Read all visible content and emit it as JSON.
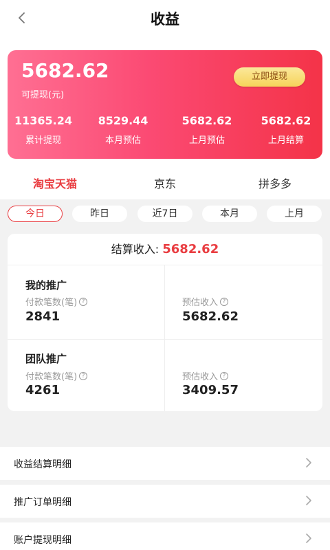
{
  "header": {
    "title": "收益"
  },
  "card": {
    "balance": "5682.62",
    "balance_label": "可提现(元)",
    "withdraw_button": "立即提现",
    "stats": [
      {
        "value": "11365.24",
        "label": "累计提现"
      },
      {
        "value": "8529.44",
        "label": "本月预估"
      },
      {
        "value": "5682.62",
        "label": "上月预估"
      },
      {
        "value": "5682.62",
        "label": "上月结算"
      }
    ]
  },
  "platform_tabs": [
    {
      "label": "淘宝天猫",
      "active": true
    },
    {
      "label": "京东",
      "active": false
    },
    {
      "label": "拼多多",
      "active": false
    }
  ],
  "periods": [
    {
      "label": "今日",
      "active": true
    },
    {
      "label": "昨日",
      "active": false
    },
    {
      "label": "近7日",
      "active": false
    },
    {
      "label": "本月",
      "active": false
    },
    {
      "label": "上月",
      "active": false
    }
  ],
  "summary": {
    "settle_label": "结算收入:",
    "settle_amount": "5682.62",
    "my_promo": {
      "title": "我的推广",
      "count_label": "付款笔数(笔)",
      "count": "2841",
      "income_label": "预估收入",
      "income": "5682.62"
    },
    "team_promo": {
      "title": "团队推广",
      "count_label": "付款笔数(笔)",
      "count": "4261",
      "income_label": "预估收入",
      "income": "3409.57"
    }
  },
  "menu": [
    {
      "label": "收益结算明细"
    },
    {
      "label": "推广订单明细"
    },
    {
      "label": "账户提现明细"
    }
  ],
  "colors": {
    "accent": "#e93d41",
    "card_start": "#ff6f93",
    "card_end": "#f43348",
    "button_gold": "#f6d35a"
  }
}
